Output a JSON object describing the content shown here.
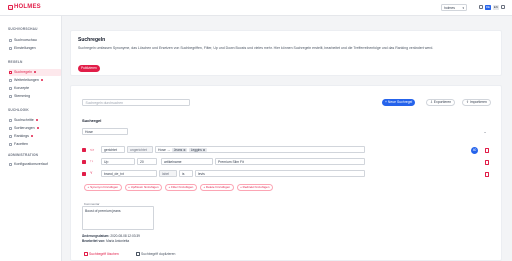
{
  "header": {
    "logo_text": "HOLMES",
    "shop_select": "holmes",
    "lang_active": "DE",
    "lang_other": "EN"
  },
  "sidebar": {
    "sections": [
      {
        "title": "SUCHVORSCHAU",
        "items": [
          {
            "label": "Suchvorschau",
            "icon": "search-icon"
          },
          {
            "label": "Einstellungen",
            "icon": "gear-icon"
          }
        ]
      },
      {
        "title": "REGELN",
        "items": [
          {
            "label": "Suchregeln",
            "icon": "rules-icon",
            "active": true,
            "dot": true
          },
          {
            "label": "Weiterleitungen",
            "icon": "redirect-icon",
            "dot": true
          },
          {
            "label": "Konzepte",
            "icon": "concept-icon"
          },
          {
            "label": "Stemming",
            "icon": "stemming-icon"
          }
        ]
      },
      {
        "title": "SUCHLOGIK",
        "items": [
          {
            "label": "Suchschritte",
            "icon": "steps-icon",
            "dot": true
          },
          {
            "label": "Sortierungen",
            "icon": "sort-icon",
            "dot": true
          },
          {
            "label": "Rankings",
            "icon": "ranking-icon",
            "dot": true
          },
          {
            "label": "Facetten",
            "icon": "facet-icon"
          }
        ]
      },
      {
        "title": "ADMINISTRATION",
        "items": [
          {
            "label": "Konfigurationsverlauf",
            "icon": "history-icon"
          }
        ]
      }
    ]
  },
  "intro": {
    "title": "Suchregeln",
    "description": "Suchregeln umfassen Synonyme, das Löschen und Ersetzen von Suchbegriffen, Filter, Up und Down Boosts und vieles mehr. Hier können Suchregeln erstellt, bearbeitet und die Trefferreihenfolge und das Ranking verändert werd.",
    "publish_label": "Publizieren"
  },
  "rules": {
    "search_placeholder": "Suchregeln durchsuchen",
    "new_button": "+ Neue Suchregel",
    "export_button": "Exportieren",
    "import_button": "Importieren",
    "section_title": "Suchregel",
    "term": "Hose",
    "rows": [
      {
        "symbol": "<>",
        "type": "gerichtet",
        "mode": "ungerichtet",
        "term": "Hose →",
        "chips": [
          "Jeans",
          "Leggins"
        ],
        "count": "40"
      },
      {
        "symbol": "↑↓",
        "type": "Up",
        "value": "20",
        "field": "artikelname",
        "text": "Premium Slim Fit"
      },
      {
        "symbol": "Y",
        "type": "brand_de_txt",
        "op": "label",
        "op2": "is",
        "value": "levis"
      }
    ],
    "add_buttons": [
      "+ Synonym hinzufügen",
      "+ Up/Down hinzufügen",
      "+ Filter hinzufügen",
      "+ Delete hinzufügen",
      "+ Redirekt hinzufügen"
    ],
    "notes_label": "Kommentar",
    "notes_value": "Boost of premium jeans",
    "changed_label": "Änderungsdatum:",
    "changed_value": "2020-08-08 12:03:39",
    "edited_label": "Bearbeitet von:",
    "edited_value": "Maria Antonietta",
    "delete_link": "Suchbegriff löschen",
    "duplicate_link": "Suchbegriff duplizieren"
  }
}
